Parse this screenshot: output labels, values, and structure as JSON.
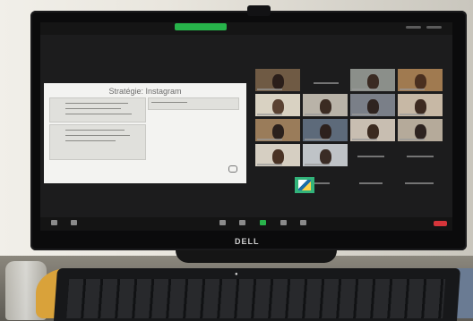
{
  "screen": {
    "slide_title": "Stratégie: Instagram",
    "brand": "DELL"
  },
  "colors": {
    "zoom_green": "#27b34a",
    "leave_red": "#d6353a",
    "active_speaker_border": "#46d246"
  },
  "icons": {
    "share": "share-screen-icon",
    "mic": "microphone-icon",
    "video": "camera-icon",
    "participants": "participants-icon",
    "chat": "chat-icon",
    "record": "record-icon",
    "reactions": "reactions-icon"
  }
}
